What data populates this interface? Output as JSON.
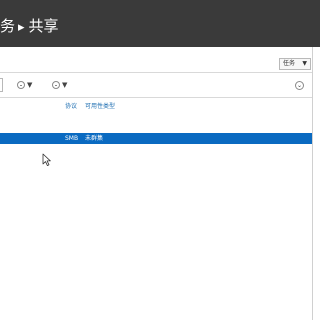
{
  "window": {
    "title_part1": "务",
    "title_separator": "▸",
    "title_part2": "共享"
  },
  "toolbar": {
    "tasks_label": "任务",
    "tasks_arrow": "▼"
  },
  "filters": {
    "chip1_arrow": "▼",
    "chip2_arrow": "▼",
    "expand_glyph": "⌄"
  },
  "table": {
    "columns": [
      "协议",
      "可用性类型"
    ],
    "rows": [
      {
        "protocol": "SMB",
        "availability": "未群集",
        "selected": true
      }
    ]
  },
  "colors": {
    "titlebar": "#3a3a3a",
    "selection": "#0a6ac1",
    "header_text": "#1f6fb2"
  }
}
